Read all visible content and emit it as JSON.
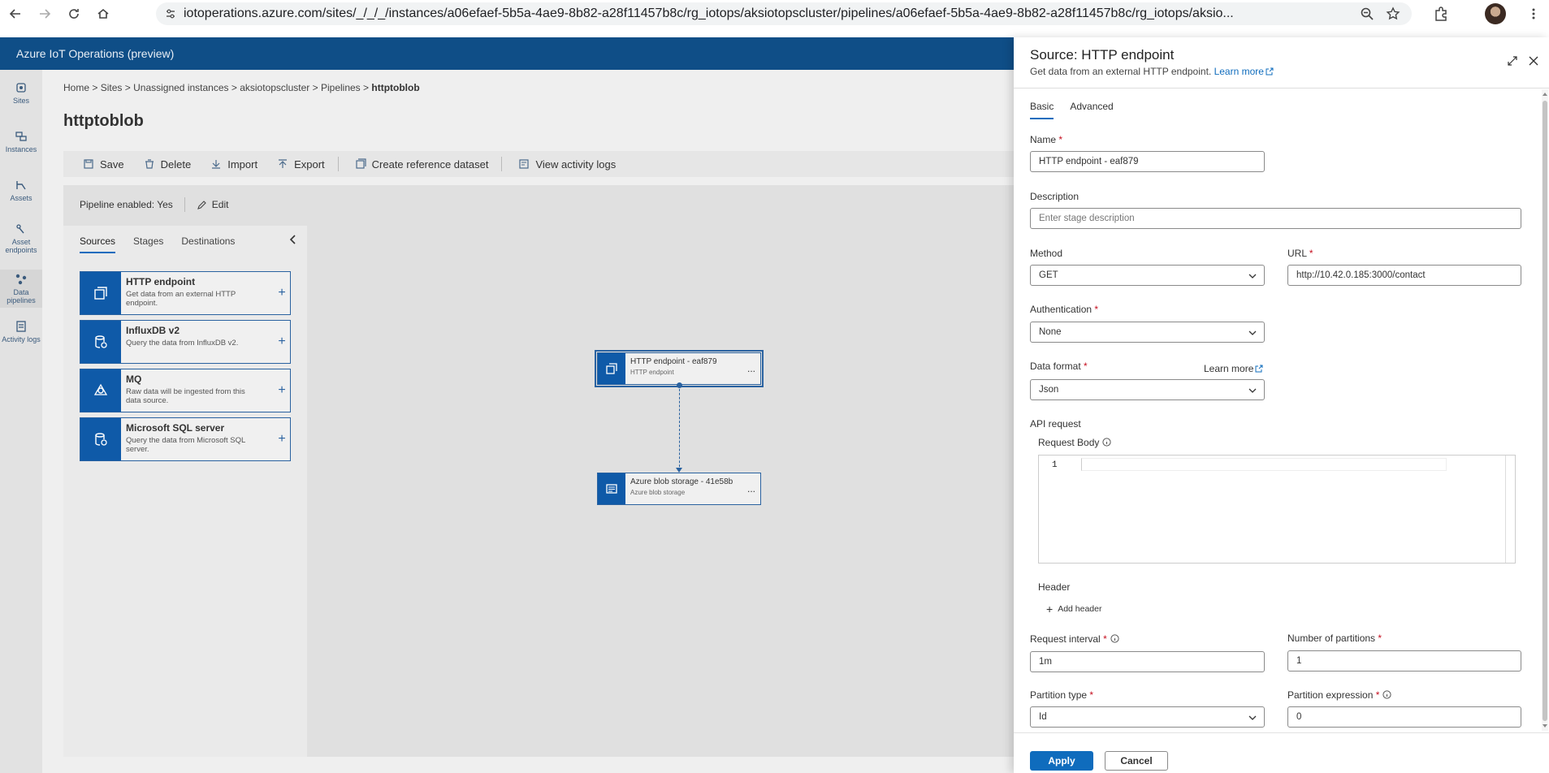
{
  "browser": {
    "url": "iotoperations.azure.com/sites/_/_/_/instances/a06efaef-5b5a-4ae9-8b82-a28f11457b8c/rg_iotops/aksiotopscluster/pipelines/a06efaef-5b5a-4ae9-8b82-a28f11457b8c/rg_iotops/aksio..."
  },
  "portal": {
    "title": "Azure IoT Operations (preview)"
  },
  "rail": [
    {
      "label": "Sites",
      "icon": "sites-icon"
    },
    {
      "label": "Instances",
      "icon": "instances-icon"
    },
    {
      "label": "Assets",
      "icon": "assets-icon"
    },
    {
      "label": "Asset endpoints",
      "icon": "asset-endpoints-icon"
    },
    {
      "label": "Data pipelines",
      "icon": "data-pipelines-icon"
    },
    {
      "label": "Activity logs",
      "icon": "activity-logs-icon"
    }
  ],
  "breadcrumb": {
    "home": "Home",
    "sites": "Sites",
    "instances": "Unassigned instances",
    "cluster": "aksiotopscluster",
    "pipelines": "Pipelines",
    "current": "httptoblob",
    "sep": ">"
  },
  "page": {
    "title": "httptoblob"
  },
  "toolbar": {
    "save": "Save",
    "delete": "Delete",
    "import": "Import",
    "export": "Export",
    "create_ref": "Create reference dataset",
    "activity": "View activity logs"
  },
  "pipeline": {
    "enabled": "Pipeline enabled: Yes",
    "edit": "Edit"
  },
  "sources_panel": {
    "tabs": [
      "Sources",
      "Stages",
      "Destinations"
    ],
    "cards": [
      {
        "name": "HTTP endpoint",
        "desc": "Get data from an external HTTP endpoint."
      },
      {
        "name": "InfluxDB v2",
        "desc": "Query the data from InfluxDB v2."
      },
      {
        "name": "MQ",
        "desc": "Raw data will be ingested from this data source."
      },
      {
        "name": "Microsoft SQL server",
        "desc": "Query the data from Microsoft SQL server."
      }
    ]
  },
  "nodes": {
    "source": {
      "name": "HTTP endpoint - eaf879",
      "type": "HTTP endpoint",
      "menu": "..."
    },
    "destination": {
      "name": "Azure blob storage - 41e58b",
      "type": "Azure blob storage",
      "menu": "..."
    }
  },
  "drawer": {
    "title": "Source: HTTP endpoint",
    "subtitle": "Get data from an external HTTP endpoint.",
    "learn_more": "Learn more",
    "tabs": [
      "Basic",
      "Advanced"
    ],
    "name_label": "Name",
    "name_value": "HTTP endpoint - eaf879",
    "description_label": "Description",
    "description_placeholder": "Enter stage description",
    "method_label": "Method",
    "method_value": "GET",
    "url_label": "URL",
    "url_value": "http://10.42.0.185:3000/contact",
    "auth_label": "Authentication",
    "auth_value": "None",
    "format_label": "Data format",
    "format_learn_more": "Learn more",
    "format_value": "Json",
    "api_request_label": "API request",
    "request_body_label": "Request Body",
    "line_number": "1",
    "header_label": "Header",
    "add_header": "Add header",
    "interval_label": "Request interval",
    "interval_value": "1m",
    "partitions_label": "Number of partitions",
    "partitions_value": "1",
    "partition_type_label": "Partition type",
    "partition_type_value": "Id",
    "partition_expr_label": "Partition expression",
    "partition_expr_value": "0",
    "required_mark": "*",
    "apply": "Apply",
    "cancel": "Cancel"
  }
}
